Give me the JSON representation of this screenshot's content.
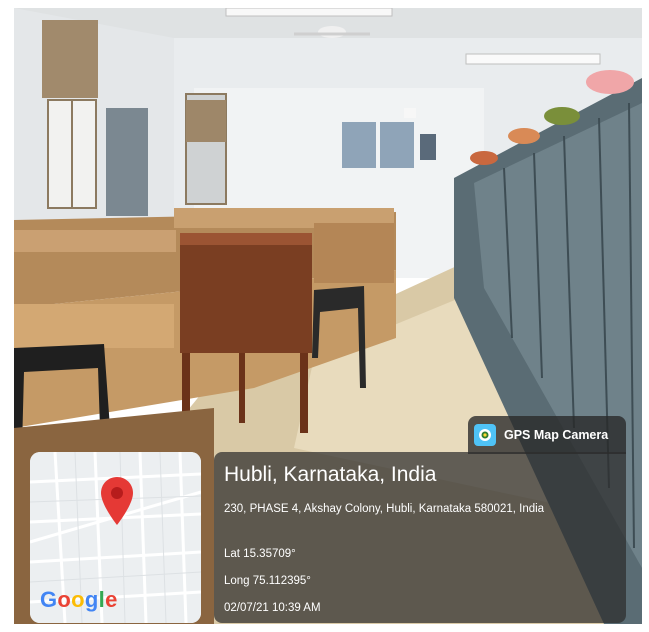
{
  "watermark": {
    "app_name": "GPS Map Camera",
    "location_title": "Hubli, Karnataka, India",
    "address": "230, PHASE 4, Akshay Colony, Hubli, Karnataka 580021, India",
    "latitude": "Lat 15.35709°",
    "longitude": "Long 75.112395°",
    "timestamp": "02/07/21 10:39 AM"
  },
  "map": {
    "logo_letters": [
      "G",
      "o",
      "o",
      "g",
      "l",
      "e"
    ],
    "pin_icon": "map-pin-icon",
    "pin_color": "#e53935"
  },
  "colors": {
    "overlay": "#2d2d2d",
    "badge_icon_bg": "#4fc3f7",
    "pin": "#e53935"
  }
}
